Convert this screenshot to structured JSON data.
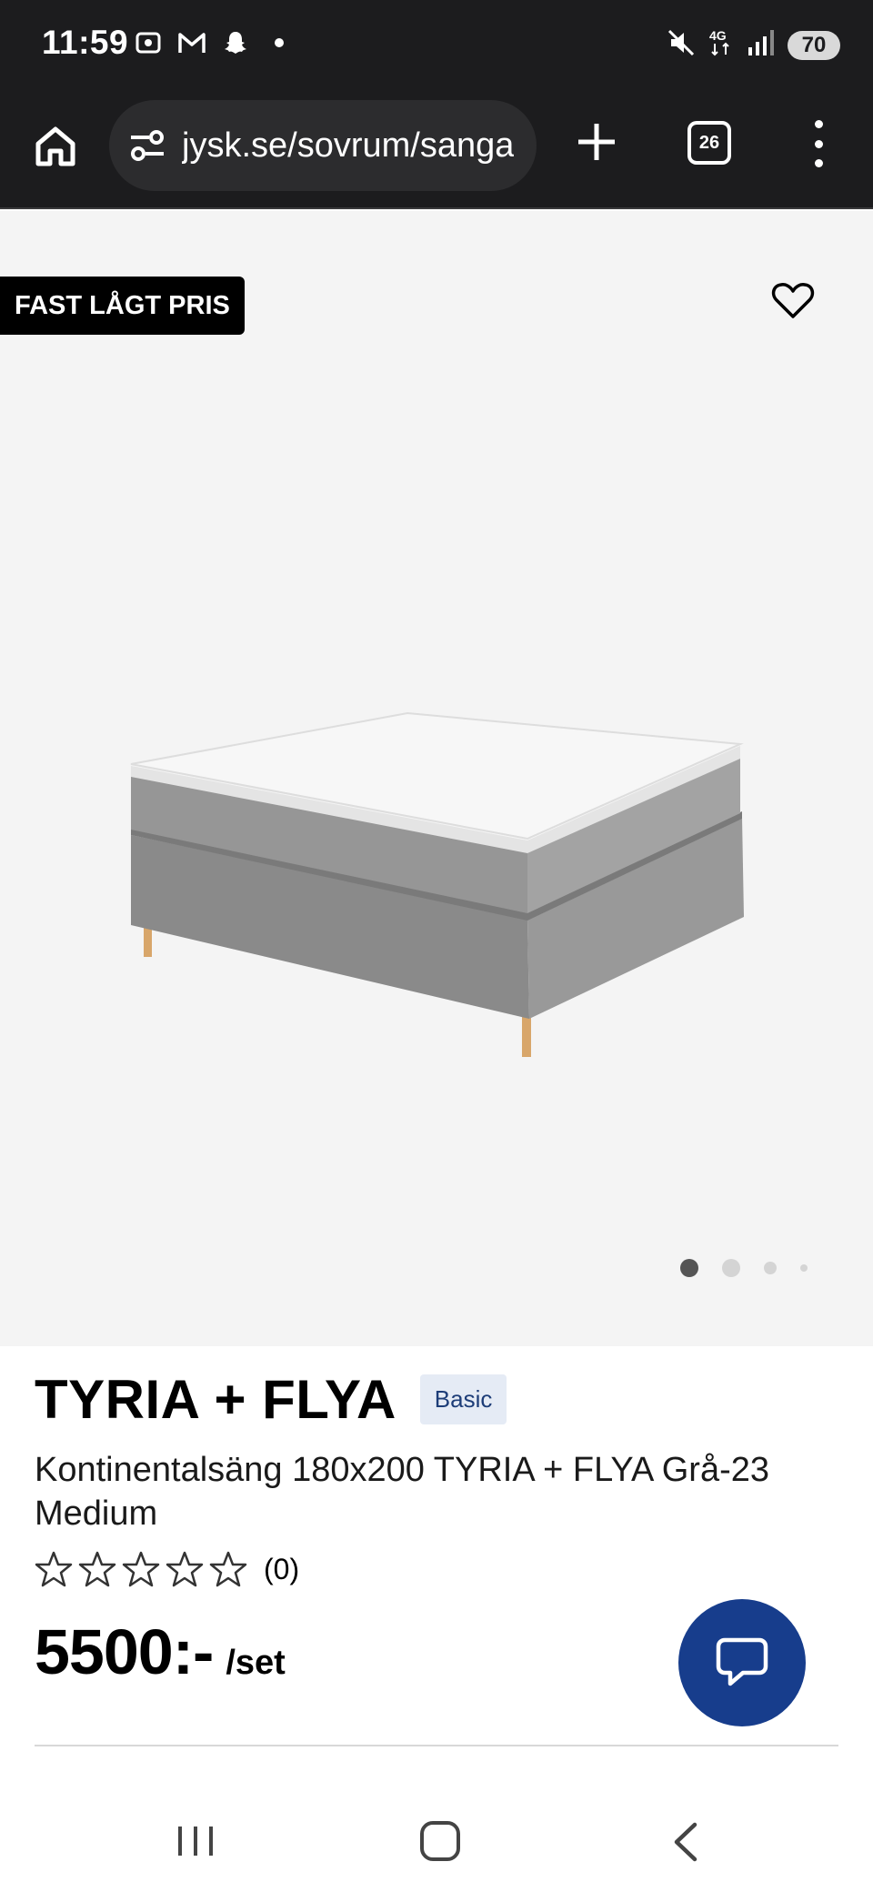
{
  "status_bar": {
    "time": "11:59",
    "left_icons": [
      "screenshot-icon",
      "gmail-icon",
      "snapchat-icon",
      "notification-dot-icon"
    ],
    "right_icons": [
      "mute-icon",
      "4g-icon",
      "signal-icon"
    ],
    "battery": "70",
    "network": "4G"
  },
  "browser": {
    "url": "jysk.se/sovrum/sanga",
    "tab_count": "26"
  },
  "product": {
    "badge": "FAST LÅGT PRIS",
    "title": "TYRIA + FLYA",
    "tag": "Basic",
    "subtitle": "Kontinentalsäng 180x200 TYRIA + FLYA Grå-23 Medium",
    "rating": {
      "stars": 0,
      "max": 5,
      "count_text": "(0)"
    },
    "price": "5500:-",
    "unit": "/set",
    "image_dots": {
      "count": 4,
      "active": 0
    }
  },
  "colors": {
    "chrome": "#1c1c1e",
    "image_bg": "#f4f4f4",
    "chat_button": "#173d8c",
    "tag_bg": "#e5ebf5",
    "tag_text": "#1d3d78"
  }
}
